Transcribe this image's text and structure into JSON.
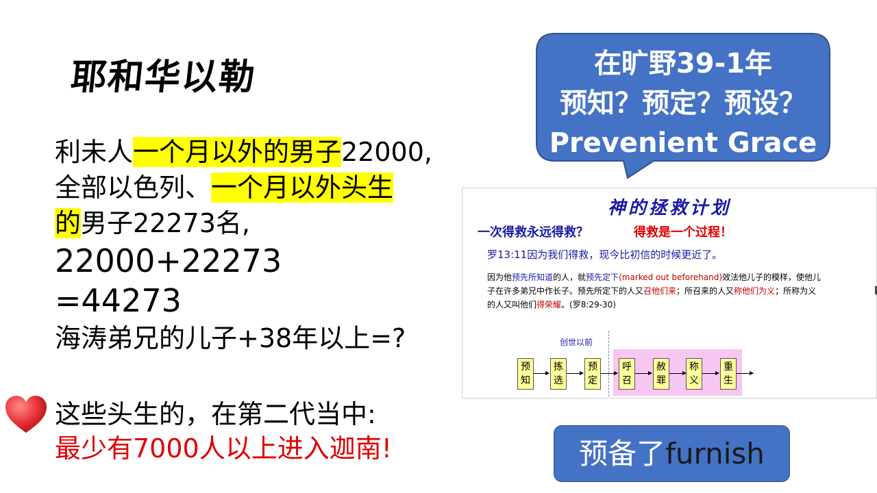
{
  "title": "耶和华以勒",
  "body": {
    "line1_a": "利未人",
    "line1_hl": "一个月以外的男子",
    "line1_b": "22000,",
    "line2_a": "全部以色列、",
    "line2_hl": "一个月以外头生",
    "line3_hl": "的",
    "line3_b": "男子22273名,",
    "sum1": "22000+22273",
    "sum2": "=44273",
    "question": "海涛弟兄的儿子+38年以上=?"
  },
  "note": {
    "line1": "这些头生的，在第二代当中:",
    "line2": "最少有7000人以上进入迦南!"
  },
  "bubble": {
    "line1": "在旷野39-1年",
    "line2": "预知？预定？预设？",
    "line3": "Prevenient Grace",
    "color": "#4472c4"
  },
  "inset": {
    "title": "神的拯救计划",
    "q1": "一次得救永远得救？",
    "q2": "得救是一个过程！",
    "verse": "罗13:11因为我们得救，现今比初信的时候更近了。",
    "para": {
      "p1": "因为他",
      "p2": "预先所知道",
      "p3": "的人，就",
      "p4": "预先定下",
      "p5": "(marked out beforehand)",
      "p6": "效法他儿子的模样，使他儿子在许多弟兄中作长子。预先所定下的人又",
      "p7": "召他们来",
      "p8": "；所召来的人又",
      "p9": "称他们为义",
      "p10": "；所称为义的人又叫他们",
      "p11": "得荣耀",
      "p12": "。(罗8:29-30)"
    },
    "flow_label": "创世以前",
    "flow": [
      {
        "top": "预",
        "bottom": "知"
      },
      {
        "top": "拣",
        "bottom": "选"
      },
      {
        "top": "预",
        "bottom": "定"
      },
      {
        "top": "呼",
        "bottom": "召"
      },
      {
        "top": "赦",
        "bottom": "罪"
      },
      {
        "top": "称",
        "bottom": "义"
      },
      {
        "top": "重",
        "bottom": "生"
      }
    ]
  },
  "furnish": {
    "part1": "预备了",
    "part2": "furnish"
  },
  "colors": {
    "highlight": "#ffff00",
    "red": "#e00000",
    "blue": "#4472c4"
  },
  "icons": {
    "heart": "heart-icon"
  }
}
